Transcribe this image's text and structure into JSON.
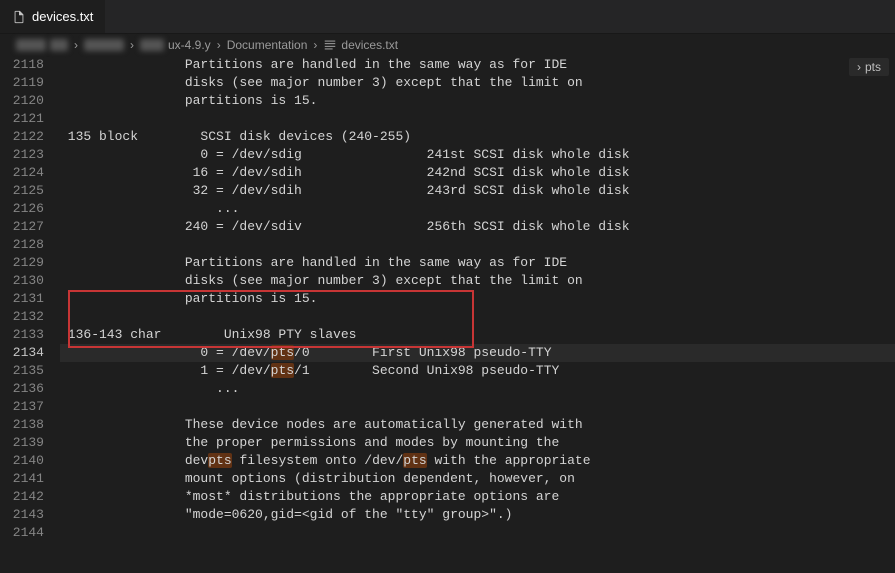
{
  "tab": {
    "filename": "devices.txt"
  },
  "breadcrumb": {
    "seg1": "ux-4.9.y",
    "seg2": "Documentation",
    "seg3": "devices.txt"
  },
  "current_line": "2134",
  "search_term": "pts",
  "minimap_breadcrumb": "pts",
  "lines": [
    {
      "n": "2118",
      "t": "\t\tPartitions are handled in the same way as for IDE"
    },
    {
      "n": "2119",
      "t": "\t\tdisks (see major number 3) except that the limit on"
    },
    {
      "n": "2120",
      "t": "\t\tpartitions is 15."
    },
    {
      "n": "2121",
      "t": ""
    },
    {
      "n": "2122",
      "t": " 135 block\tSCSI disk devices (240-255)"
    },
    {
      "n": "2123",
      "t": "\t\t  0 = /dev/sdig\t\t241st SCSI disk whole disk"
    },
    {
      "n": "2124",
      "t": "\t\t 16 = /dev/sdih\t\t242nd SCSI disk whole disk"
    },
    {
      "n": "2125",
      "t": "\t\t 32 = /dev/sdih\t\t243rd SCSI disk whole disk"
    },
    {
      "n": "2126",
      "t": "\t\t    ..."
    },
    {
      "n": "2127",
      "t": "\t\t240 = /dev/sdiv\t\t256th SCSI disk whole disk"
    },
    {
      "n": "2128",
      "t": ""
    },
    {
      "n": "2129",
      "t": "\t\tPartitions are handled in the same way as for IDE"
    },
    {
      "n": "2130",
      "t": "\t\tdisks (see major number 3) except that the limit on"
    },
    {
      "n": "2131",
      "t": "\t\tpartitions is 15."
    },
    {
      "n": "2132",
      "t": ""
    },
    {
      "n": "2133",
      "t": " 136-143 char\tUnix98 PTY slaves"
    },
    {
      "n": "2134",
      "t": "\t\t  0 = /dev/|pts|/0\tFirst Unix98 pseudo-TTY"
    },
    {
      "n": "2135",
      "t": "\t\t  1 = /dev/|pts|/1\tSecond Unix98 pseudo-TTY"
    },
    {
      "n": "2136",
      "t": "\t\t    ..."
    },
    {
      "n": "2137",
      "t": ""
    },
    {
      "n": "2138",
      "t": "\t\tThese device nodes are automatically generated with"
    },
    {
      "n": "2139",
      "t": "\t\tthe proper permissions and modes by mounting the"
    },
    {
      "n": "2140",
      "t": "\t\tdev|pts| filesystem onto /dev/|pts| with the appropriate"
    },
    {
      "n": "2141",
      "t": "\t\tmount options (distribution dependent, however, on"
    },
    {
      "n": "2142",
      "t": "\t\t*most* distributions the appropriate options are"
    },
    {
      "n": "2143",
      "t": "\t\t\"mode=0620,gid=<gid of the \"tty\" group>\".)"
    },
    {
      "n": "2144",
      "t": ""
    }
  ],
  "colors": {
    "bg": "#1e1e1e",
    "fg": "#d4d4d4",
    "gutter": "#858585",
    "search_hl": "#613214",
    "annotation_box": "#c73535"
  }
}
